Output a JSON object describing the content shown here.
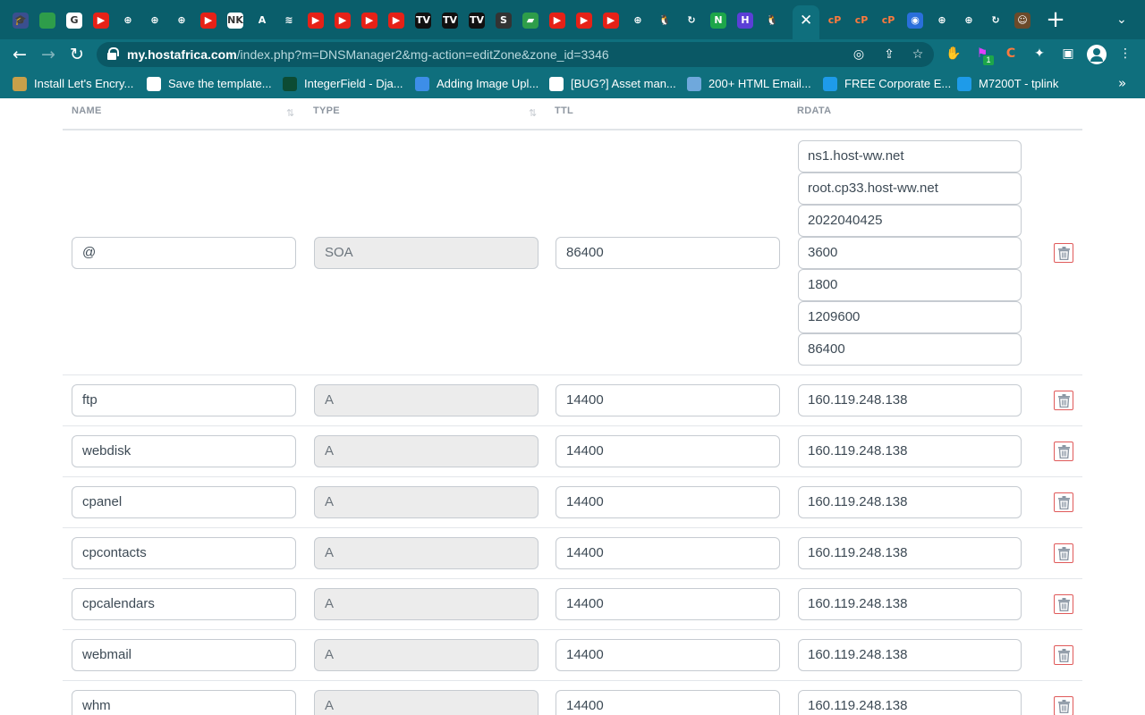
{
  "browser": {
    "tabs": [
      {
        "icon": "graduation-cap-icon",
        "color": "#3a4f8f",
        "glyph": "🎓"
      },
      {
        "icon": "leaf-icon",
        "color": "#2e9d4a",
        "glyph": ""
      },
      {
        "icon": "google-icon",
        "color": "#ffffff",
        "glyph": "G"
      },
      {
        "icon": "youtube-icon",
        "color": "#e62117",
        "glyph": "▶"
      },
      {
        "icon": "globe-icon",
        "color": "#0a5e6b",
        "glyph": "⊕"
      },
      {
        "icon": "globe-icon",
        "color": "#0a5e6b",
        "glyph": "⊕"
      },
      {
        "icon": "globe-icon",
        "color": "#0a5e6b",
        "glyph": "⊕"
      },
      {
        "icon": "youtube-icon",
        "color": "#e62117",
        "glyph": "▶"
      },
      {
        "icon": "nk-icon",
        "color": "#ffffff",
        "glyph": "NK"
      },
      {
        "icon": "letter-a-icon",
        "color": "#0a5e6b",
        "glyph": "A"
      },
      {
        "icon": "database-icon",
        "color": "#0a5e6b",
        "glyph": "≋"
      },
      {
        "icon": "youtube-icon",
        "color": "#e62117",
        "glyph": "▶"
      },
      {
        "icon": "youtube-icon",
        "color": "#e62117",
        "glyph": "▶"
      },
      {
        "icon": "youtube-icon",
        "color": "#e62117",
        "glyph": "▶"
      },
      {
        "icon": "youtube-icon",
        "color": "#e62117",
        "glyph": "▶"
      },
      {
        "icon": "tradingview-icon",
        "color": "#111111",
        "glyph": "TV"
      },
      {
        "icon": "tradingview-icon",
        "color": "#111111",
        "glyph": "TV"
      },
      {
        "icon": "tradingview-icon",
        "color": "#111111",
        "glyph": "TV"
      },
      {
        "icon": "letter-s-icon",
        "color": "#333333",
        "glyph": "S"
      },
      {
        "icon": "book-icon",
        "color": "#2e9d4a",
        "glyph": "▰"
      },
      {
        "icon": "youtube-icon",
        "color": "#e62117",
        "glyph": "▶"
      },
      {
        "icon": "youtube-icon",
        "color": "#e62117",
        "glyph": "▶"
      },
      {
        "icon": "youtube-icon",
        "color": "#e62117",
        "glyph": "▶"
      },
      {
        "icon": "globe-icon",
        "color": "#0a5e6b",
        "glyph": "⊕"
      },
      {
        "icon": "penguin-icon",
        "color": "#0a5e6b",
        "glyph": "🐧"
      },
      {
        "icon": "refresh-icon",
        "color": "#0a5e6b",
        "glyph": "↻"
      },
      {
        "icon": "n-icon",
        "color": "#1da64a",
        "glyph": "N"
      },
      {
        "icon": "h-icon",
        "color": "#5b3fd6",
        "glyph": "H"
      },
      {
        "icon": "penguin-icon",
        "color": "#0a5e6b",
        "glyph": "🐧"
      }
    ],
    "tabs_after_active": [
      {
        "icon": "cpanel-icon",
        "color": "#0a5e6b",
        "glyph": "cP"
      },
      {
        "icon": "cpanel-icon",
        "color": "#0a5e6b",
        "glyph": "cP"
      },
      {
        "icon": "cpanel-icon",
        "color": "#0a5e6b",
        "glyph": "cP"
      },
      {
        "icon": "target-icon",
        "color": "#2a6fdb",
        "glyph": "◉"
      },
      {
        "icon": "globe-icon",
        "color": "#0a5e6b",
        "glyph": "⊕"
      },
      {
        "icon": "globe-icon",
        "color": "#0a5e6b",
        "glyph": "⊕"
      },
      {
        "icon": "refresh-icon",
        "color": "#0a5e6b",
        "glyph": "↻"
      },
      {
        "icon": "person-icon",
        "color": "#6b4a2a",
        "glyph": "☺"
      }
    ],
    "url_domain": "my.hostafrica.com",
    "url_path": "/index.php?m=DNSManager2&mg-action=editZone&zone_id=3346",
    "extension_badge": "1",
    "bookmarks": [
      {
        "label": "Install Let's Encry...",
        "icon": "letsencrypt-icon",
        "color": "#c8a04a"
      },
      {
        "label": "Save the template...",
        "icon": "github-icon",
        "color": "#ffffff"
      },
      {
        "label": "IntegerField - Dja...",
        "icon": "django-icon",
        "color": "#0c4b33"
      },
      {
        "label": "Adding Image Upl...",
        "icon": "cloud-icon",
        "color": "#3d8ee8"
      },
      {
        "label": "[BUG?] Asset man...",
        "icon": "github-icon",
        "color": "#ffffff"
      },
      {
        "label": "200+ HTML Email...",
        "icon": "triangle-icon",
        "color": "#6fa8dc"
      },
      {
        "label": "FREE Corporate E...",
        "icon": "t-icon",
        "color": "#1e9be9"
      },
      {
        "label": "M7200T - tplink",
        "icon": "tplink-icon",
        "color": "#1e9be9"
      }
    ]
  },
  "table": {
    "headers": {
      "name": "NAME",
      "type": "TYPE",
      "ttl": "TTL",
      "rdata": "RDATA"
    },
    "soa": {
      "name": "@",
      "type": "SOA",
      "ttl": "86400",
      "rdata": [
        "ns1.host-ww.net",
        "root.cp33.host-ww.net",
        "2022040425",
        "3600",
        "1800",
        "1209600",
        "86400"
      ]
    },
    "records": [
      {
        "name": "ftp",
        "type": "A",
        "ttl": "14400",
        "rdata": "160.119.248.138"
      },
      {
        "name": "webdisk",
        "type": "A",
        "ttl": "14400",
        "rdata": "160.119.248.138"
      },
      {
        "name": "cpanel",
        "type": "A",
        "ttl": "14400",
        "rdata": "160.119.248.138"
      },
      {
        "name": "cpcontacts",
        "type": "A",
        "ttl": "14400",
        "rdata": "160.119.248.138"
      },
      {
        "name": "cpcalendars",
        "type": "A",
        "ttl": "14400",
        "rdata": "160.119.248.138"
      },
      {
        "name": "webmail",
        "type": "A",
        "ttl": "14400",
        "rdata": "160.119.248.138"
      },
      {
        "name": "whm",
        "type": "A",
        "ttl": "14400",
        "rdata": "160.119.248.138"
      }
    ]
  },
  "colors": {
    "chrome": "#0f6f7d",
    "delete": "#e05a5a"
  }
}
